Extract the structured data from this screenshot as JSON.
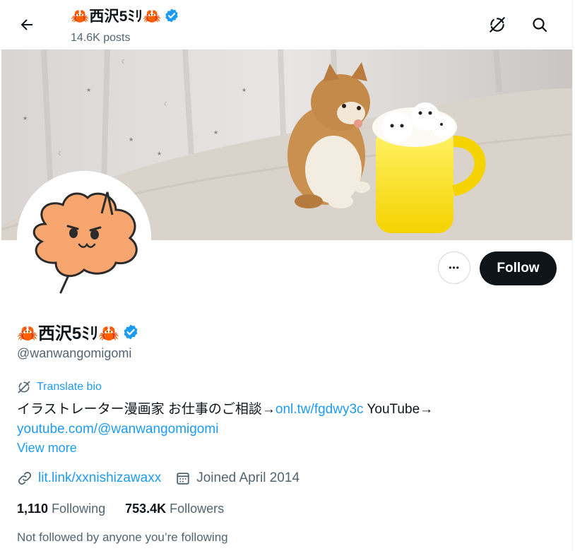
{
  "topbar": {
    "name": "🦀西沢5ﾐﾘ🦀",
    "posts": "14.6K posts",
    "icons": {
      "back": "arrow-left-icon",
      "translate": "no-sync-icon",
      "search": "search-icon"
    }
  },
  "profile": {
    "display_name": "🦀西沢5ﾐﾘ🦀",
    "handle": "@wanwangomigomi",
    "verified_color": "#1d9bf0",
    "follow_label": "Follow",
    "more_label": "•••",
    "translate_label": "Translate bio",
    "bio_text_1": "イラストレーター漫画家 お仕事のご相談→",
    "bio_link_1": "onl.tw/fgdwy3c",
    "bio_text_2": " YouTube→",
    "bio_link_2": "youtube.com/@wanwangomigomi",
    "view_more": "View more",
    "website": "lit.link/xxnishizawaxx",
    "joined": "Joined April 2014",
    "following_count": "1,110",
    "following_label": "Following",
    "followers_count": "753.4K",
    "followers_label": "Followers",
    "not_followed": "Not followed by anyone you’re following"
  },
  "colors": {
    "accent": "#1d9bf0",
    "text": "#0f1419",
    "secondary": "#536471",
    "avatar_blob": "#f6a66e"
  }
}
